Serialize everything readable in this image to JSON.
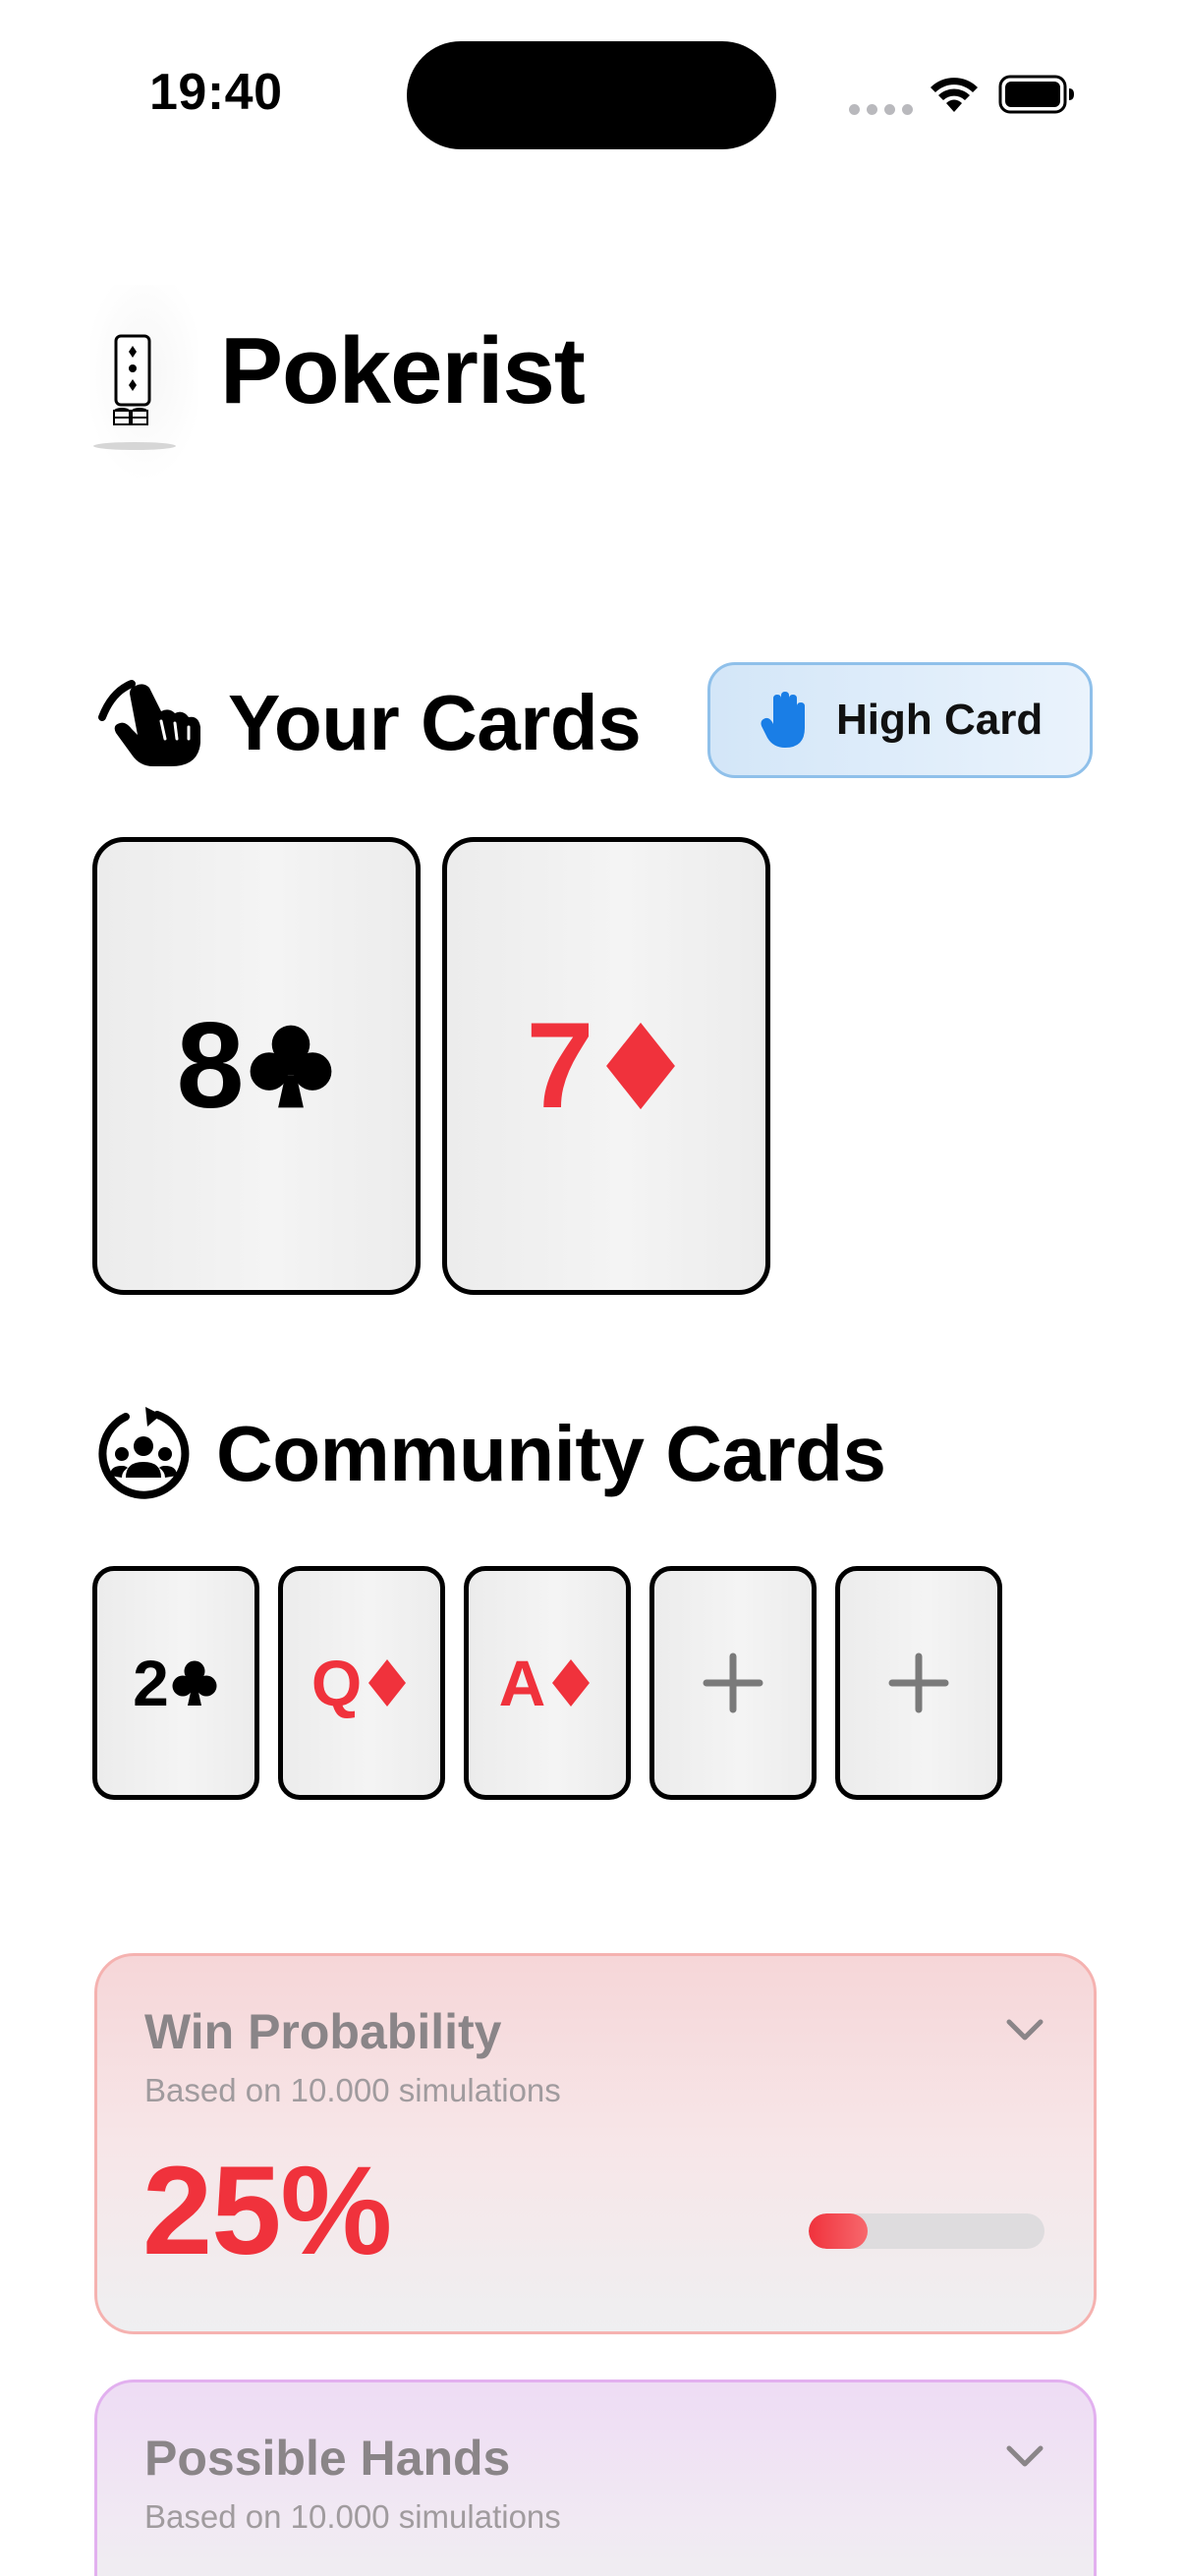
{
  "status_bar": {
    "time": "19:40"
  },
  "app": {
    "title": "Pokerist",
    "logo_icon": "card-and-chips-logo"
  },
  "your_cards": {
    "title": "Your Cards",
    "icon": "hand-pointing-icon",
    "hand_badge": {
      "label": "High Card",
      "icon": "raised-hand-icon",
      "color": "#1a7ee6"
    },
    "cards": [
      {
        "rank": "8",
        "suit": "clubs",
        "color": "black"
      },
      {
        "rank": "7",
        "suit": "diamonds",
        "color": "red"
      }
    ]
  },
  "community_cards": {
    "title": "Community Cards",
    "icon": "group-cycle-icon",
    "cards": [
      {
        "rank": "2",
        "suit": "clubs",
        "color": "black"
      },
      {
        "rank": "Q",
        "suit": "diamonds",
        "color": "red"
      },
      {
        "rank": "A",
        "suit": "diamonds",
        "color": "red"
      },
      {
        "empty": true,
        "icon": "plus-icon"
      },
      {
        "empty": true,
        "icon": "plus-icon"
      }
    ]
  },
  "win_probability": {
    "title": "Win Probability",
    "subtitle": "Based on 10.000 simulations",
    "value": "25%",
    "progress": 0.25,
    "accent": "#f0323c"
  },
  "possible_hands": {
    "title": "Possible Hands",
    "subtitle": "Based on 10.000 simulations"
  },
  "colors": {
    "red_suit": "#f0323c",
    "black_suit": "#000000",
    "card_bg": "#efefef"
  }
}
